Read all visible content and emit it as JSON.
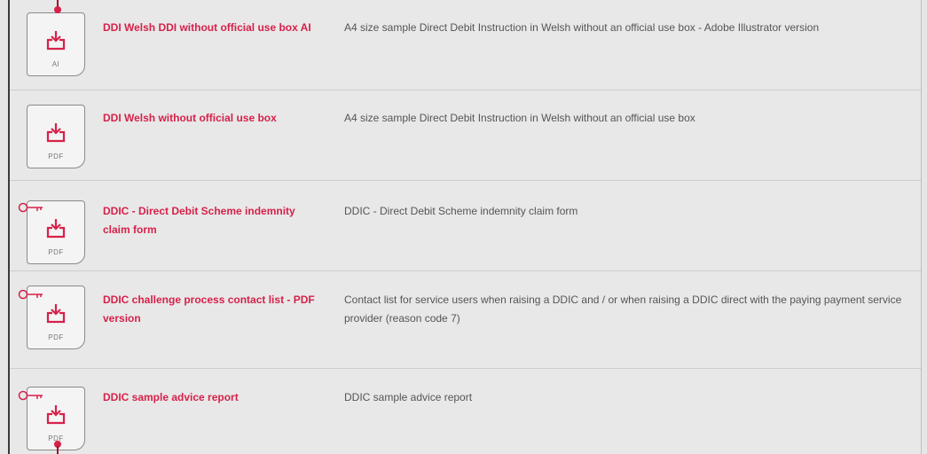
{
  "items": [
    {
      "title": "DDI Welsh DDI without official use box AI",
      "description": "A4 size sample Direct Debit Instruction in Welsh without an official use box - Adobe Illustrator version",
      "file_type": "AI",
      "icon": "download-icon",
      "locked": false
    },
    {
      "title": "DDI Welsh without official use box",
      "description": "A4 size sample Direct Debit Instruction in Welsh without an official use box",
      "file_type": "PDF",
      "icon": "download-icon",
      "locked": false
    },
    {
      "title": "DDIC - Direct Debit Scheme indemnity claim form",
      "description": "DDIC - Direct Debit Scheme indemnity claim form",
      "file_type": "PDF",
      "icon": "download-icon",
      "locked": true
    },
    {
      "title": "DDIC challenge process contact list - PDF version",
      "description": "Contact list for service users when raising a DDIC and / or when raising a DDIC direct with the paying payment service provider (reason code 7)",
      "file_type": "PDF",
      "icon": "download-icon",
      "locked": true
    },
    {
      "title": "DDIC sample advice report",
      "description": "DDIC sample advice report",
      "file_type": "PDF",
      "icon": "download-icon",
      "locked": true
    }
  ],
  "colors": {
    "accent": "#d6214a",
    "text": "#555555",
    "background": "#e8e8e8"
  }
}
